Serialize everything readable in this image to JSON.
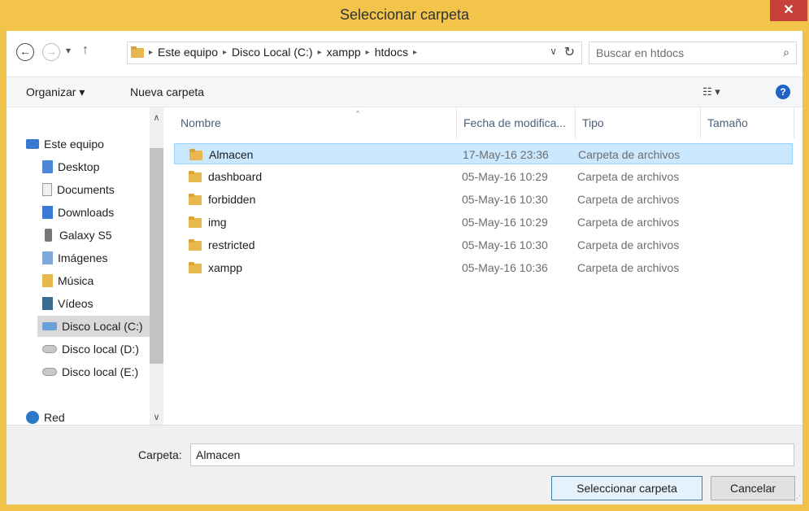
{
  "window": {
    "title": "Seleccionar carpeta",
    "close_glyph": "✕"
  },
  "nav": {
    "back_glyph": "←",
    "forward_glyph": "→",
    "recent_glyph": "▾",
    "up_glyph": "↑"
  },
  "address": {
    "crumbs": [
      "Este equipo",
      "Disco Local (C:)",
      "xampp",
      "htdocs"
    ],
    "separator": "▸",
    "dropdown_glyph": "∨",
    "refresh_glyph": "↻"
  },
  "search": {
    "placeholder": "Buscar en htdocs",
    "icon_glyph": "⌕"
  },
  "toolbar": {
    "organize_label": "Organizar ▾",
    "new_folder_label": "Nueva carpeta",
    "view_glyph": "☷ ▾",
    "help_glyph": "?"
  },
  "sidebar": {
    "items": [
      {
        "label": "Este equipo",
        "icon": "computer-icon"
      },
      {
        "label": "Desktop",
        "icon": "desktop-icon"
      },
      {
        "label": "Documents",
        "icon": "documents-icon"
      },
      {
        "label": "Downloads",
        "icon": "downloads-icon"
      },
      {
        "label": "Galaxy S5",
        "icon": "phone-icon"
      },
      {
        "label": "Imágenes",
        "icon": "pictures-icon"
      },
      {
        "label": "Música",
        "icon": "music-icon"
      },
      {
        "label": "Vídeos",
        "icon": "videos-icon"
      },
      {
        "label": "Disco Local (C:)",
        "icon": "local-drive-icon"
      },
      {
        "label": "Disco local (D:)",
        "icon": "drive-icon"
      },
      {
        "label": "Disco local (E:)",
        "icon": "drive-icon"
      },
      {
        "label": "Red",
        "icon": "network-icon"
      }
    ],
    "selected_index": 8,
    "scroll_up_glyph": "∧",
    "scroll_down_glyph": "∨"
  },
  "table": {
    "columns": [
      "Nombre",
      "Fecha de modifica...",
      "Tipo",
      "Tamaño"
    ],
    "sort_glyph": "^",
    "rows": [
      {
        "name": "Almacen",
        "date": "17-May-16 23:36",
        "type": "Carpeta de archivos"
      },
      {
        "name": "dashboard",
        "date": "05-May-16 10:29",
        "type": "Carpeta de archivos"
      },
      {
        "name": "forbidden",
        "date": "05-May-16 10:30",
        "type": "Carpeta de archivos"
      },
      {
        "name": "img",
        "date": "05-May-16 10:29",
        "type": "Carpeta de archivos"
      },
      {
        "name": "restricted",
        "date": "05-May-16 10:30",
        "type": "Carpeta de archivos"
      },
      {
        "name": "xampp",
        "date": "05-May-16 10:36",
        "type": "Carpeta de archivos"
      }
    ],
    "selected_index": 0
  },
  "footer": {
    "folder_label": "Carpeta:",
    "folder_value": "Almacen",
    "select_button": "Seleccionar carpeta",
    "cancel_button": "Cancelar"
  },
  "colors": {
    "title_bar": "#f3c44a",
    "close_button": "#c7403a",
    "selection": "#cce8ff",
    "accent": "#3c7fb1"
  }
}
